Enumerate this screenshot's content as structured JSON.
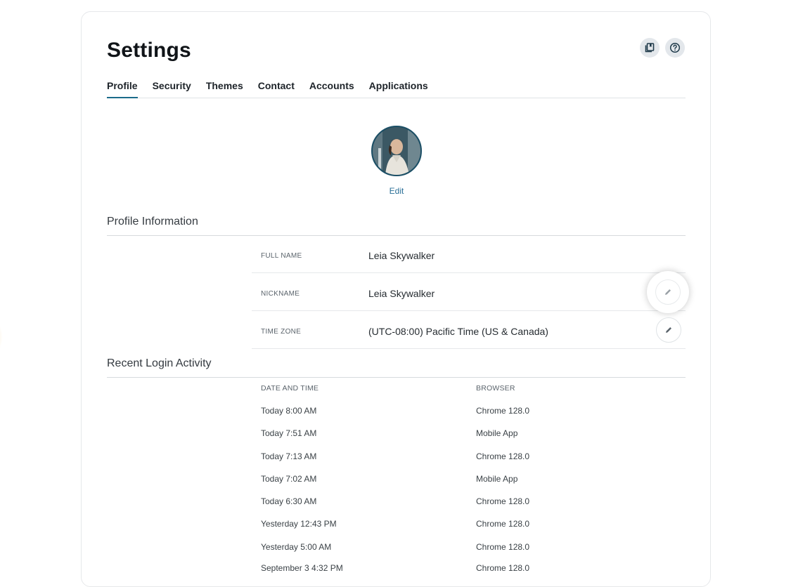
{
  "header": {
    "title": "Settings",
    "icons": [
      "book-icon",
      "help-icon"
    ]
  },
  "tabs": [
    {
      "label": "Profile",
      "active": true
    },
    {
      "label": "Security",
      "active": false
    },
    {
      "label": "Themes",
      "active": false
    },
    {
      "label": "Contact",
      "active": false
    },
    {
      "label": "Accounts",
      "active": false
    },
    {
      "label": "Applications",
      "active": false
    }
  ],
  "avatar": {
    "edit_label": "Edit"
  },
  "profile_info": {
    "title": "Profile Information",
    "rows": [
      {
        "label": "FULL NAME",
        "value": "Leia Skywalker",
        "editable": false
      },
      {
        "label": "NICKNAME",
        "value": "Leia Skywalker",
        "editable": true
      },
      {
        "label": "TIME ZONE",
        "value": "(UTC-08:00) Pacific Time (US & Canada)",
        "editable": true
      }
    ]
  },
  "login_activity": {
    "title": "Recent Login Activity",
    "columns": [
      "DATE AND TIME",
      "BROWSER"
    ],
    "rows": [
      {
        "datetime": "Today 8:00 AM",
        "browser": "Chrome 128.0"
      },
      {
        "datetime": "Today 7:51 AM",
        "browser": "Mobile App"
      },
      {
        "datetime": "Today 7:13 AM",
        "browser": "Chrome 128.0"
      },
      {
        "datetime": "Today 7:02 AM",
        "browser": "Mobile App"
      },
      {
        "datetime": "Today 6:30 AM",
        "browser": "Chrome 128.0"
      },
      {
        "datetime": "Yesterday 12:43 PM",
        "browser": "Chrome 128.0"
      },
      {
        "datetime": "Yesterday 5:00 AM",
        "browser": "Chrome 128.0"
      },
      {
        "datetime": "September 3 4:32 PM",
        "browser": "Chrome 128.0"
      }
    ]
  },
  "colors": {
    "accent": "#1b6b8a",
    "link": "#2a6f97"
  }
}
